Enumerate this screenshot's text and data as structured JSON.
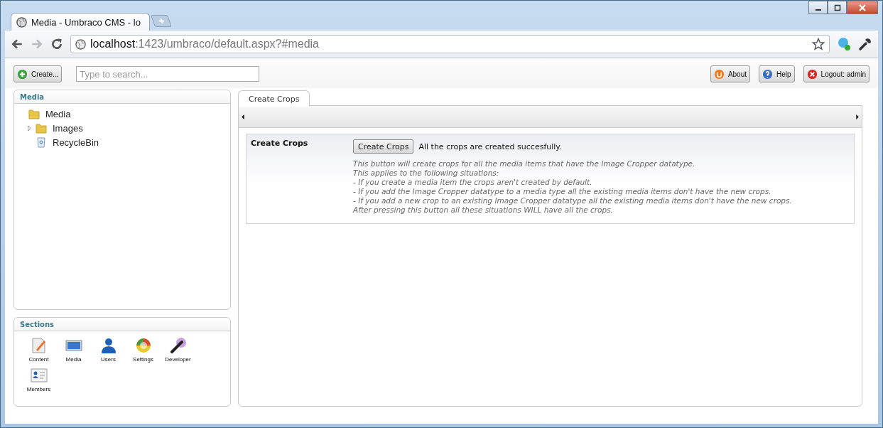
{
  "browser": {
    "tab_title": "Media - Umbraco CMS - lo",
    "address_host": "localhost",
    "address_path": ":1423/umbraco/default.aspx?#media"
  },
  "toolbar": {
    "create_button": "Create...",
    "search": {
      "placeholder": "Type to search..."
    },
    "buttons": [
      {
        "label": "About",
        "kind": "about"
      },
      {
        "label": "Help",
        "kind": "help"
      },
      {
        "label": "Logout: admin",
        "kind": "logout"
      }
    ]
  },
  "tree": {
    "title": "Media",
    "items": [
      {
        "label": "Media",
        "kind": "folder",
        "children": [
          {
            "label": "Images",
            "kind": "folder",
            "expanded": false
          },
          {
            "label": "RecycleBin",
            "kind": "bin"
          }
        ]
      }
    ]
  },
  "sections": {
    "title": "Sections",
    "items": [
      {
        "label": "Content",
        "kind": "content"
      },
      {
        "label": "Media",
        "kind": "media"
      },
      {
        "label": "Users",
        "kind": "users"
      },
      {
        "label": "Settings",
        "kind": "settings"
      },
      {
        "label": "Developer",
        "kind": "developer"
      },
      {
        "label": "Members",
        "kind": "members"
      }
    ]
  },
  "panel": {
    "tabs": [
      {
        "label": "Create Crops",
        "selected": true
      }
    ],
    "property": {
      "label": "Create Crops",
      "button": "Create Crops",
      "message": "All the crops are created succesfully.",
      "description_lines": [
        "This button will create crops for all the media items that have the Image Cropper datatype.",
        "This applies to the following situations:",
        "- If you create a media item the crops aren't created by default.",
        "- If you add the Image Cropper datatype to a media type all the existing media items don't have the new crops.",
        "- If you add a new crop to an existing Image Cropper datatype all the existing media items don't have the new crops.",
        "After pressing this button all these situations WILL have all the crops."
      ]
    }
  }
}
